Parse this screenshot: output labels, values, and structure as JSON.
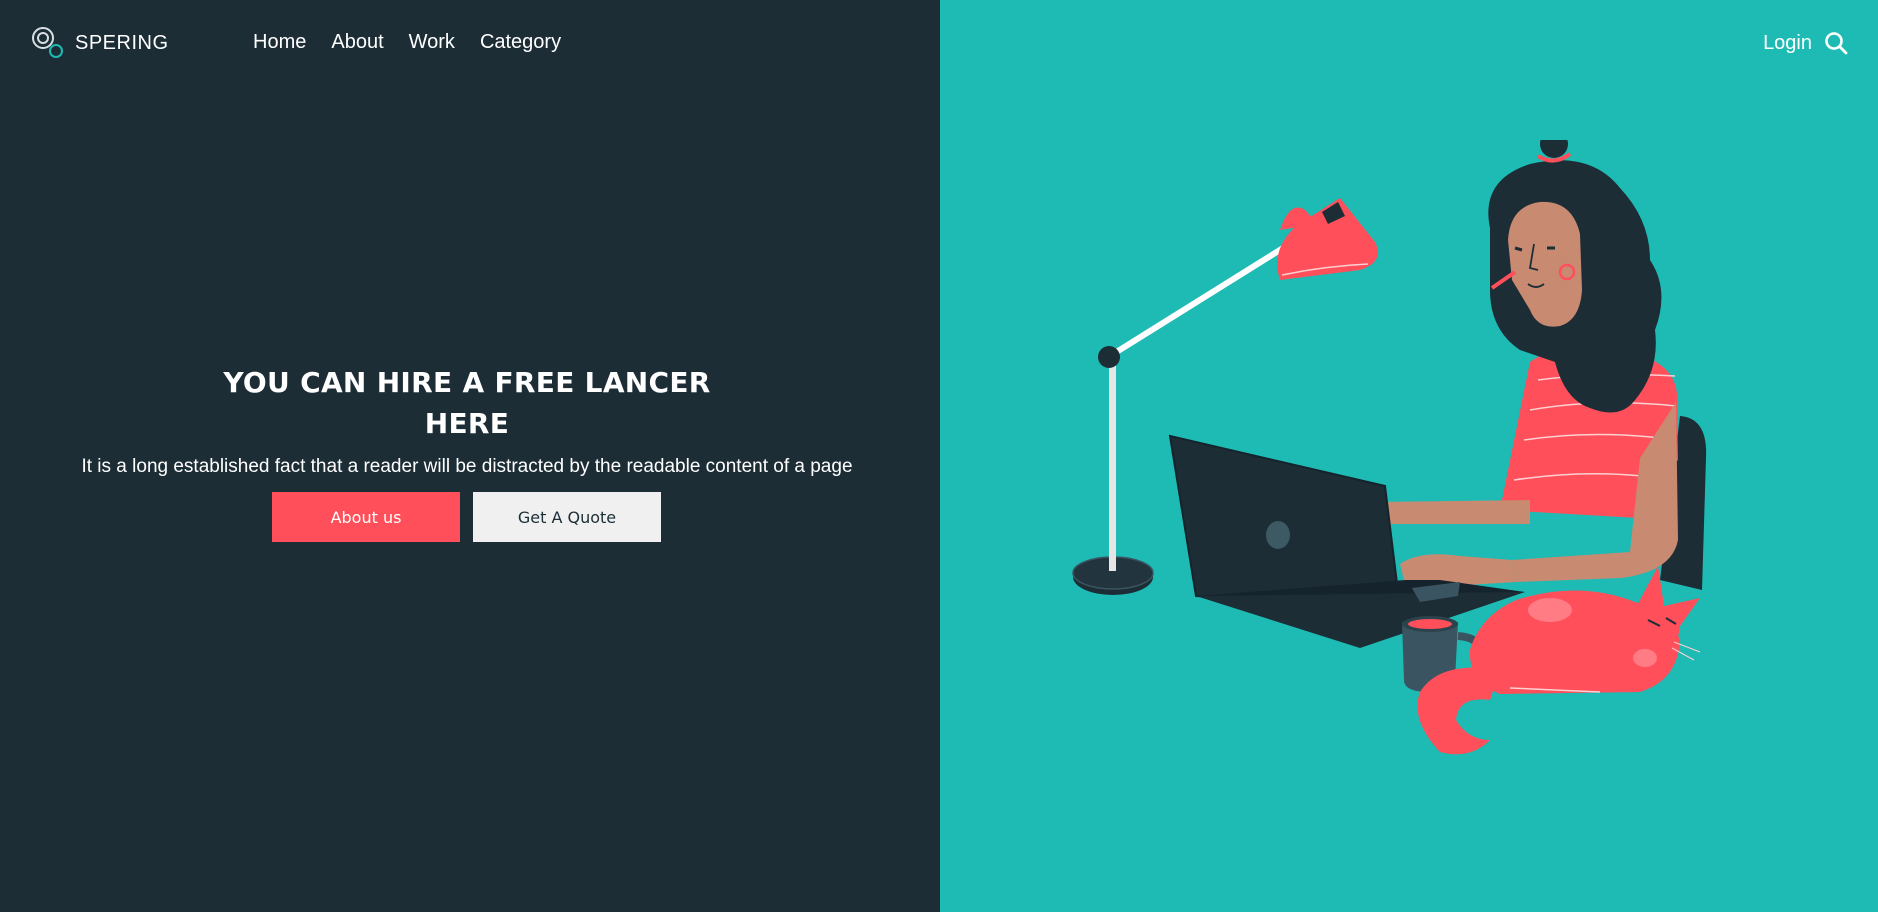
{
  "brand": {
    "name": "SPERING",
    "logo_icon": "circles-logo-icon"
  },
  "nav": {
    "items": [
      {
        "label": "Home"
      },
      {
        "label": "About"
      },
      {
        "label": "Work"
      },
      {
        "label": "Category"
      }
    ]
  },
  "header": {
    "login_label": "Login",
    "search_icon": "search-icon"
  },
  "hero": {
    "title": "YOU CAN HIRE A FREE LANCER HERE",
    "subtitle": "It is a long established fact that a reader will be distracted by the readable content of a page",
    "primary_button": "About us",
    "secondary_button": "Get A Quote"
  },
  "colors": {
    "dark_panel": "#1c2d36",
    "teal_panel": "#1ebbb4",
    "accent": "#ff4f5a",
    "light_button": "#f0f0f0"
  },
  "illustration": {
    "subject": "woman-working-at-laptop-with-lamp-mug-and-cat-illustration"
  }
}
